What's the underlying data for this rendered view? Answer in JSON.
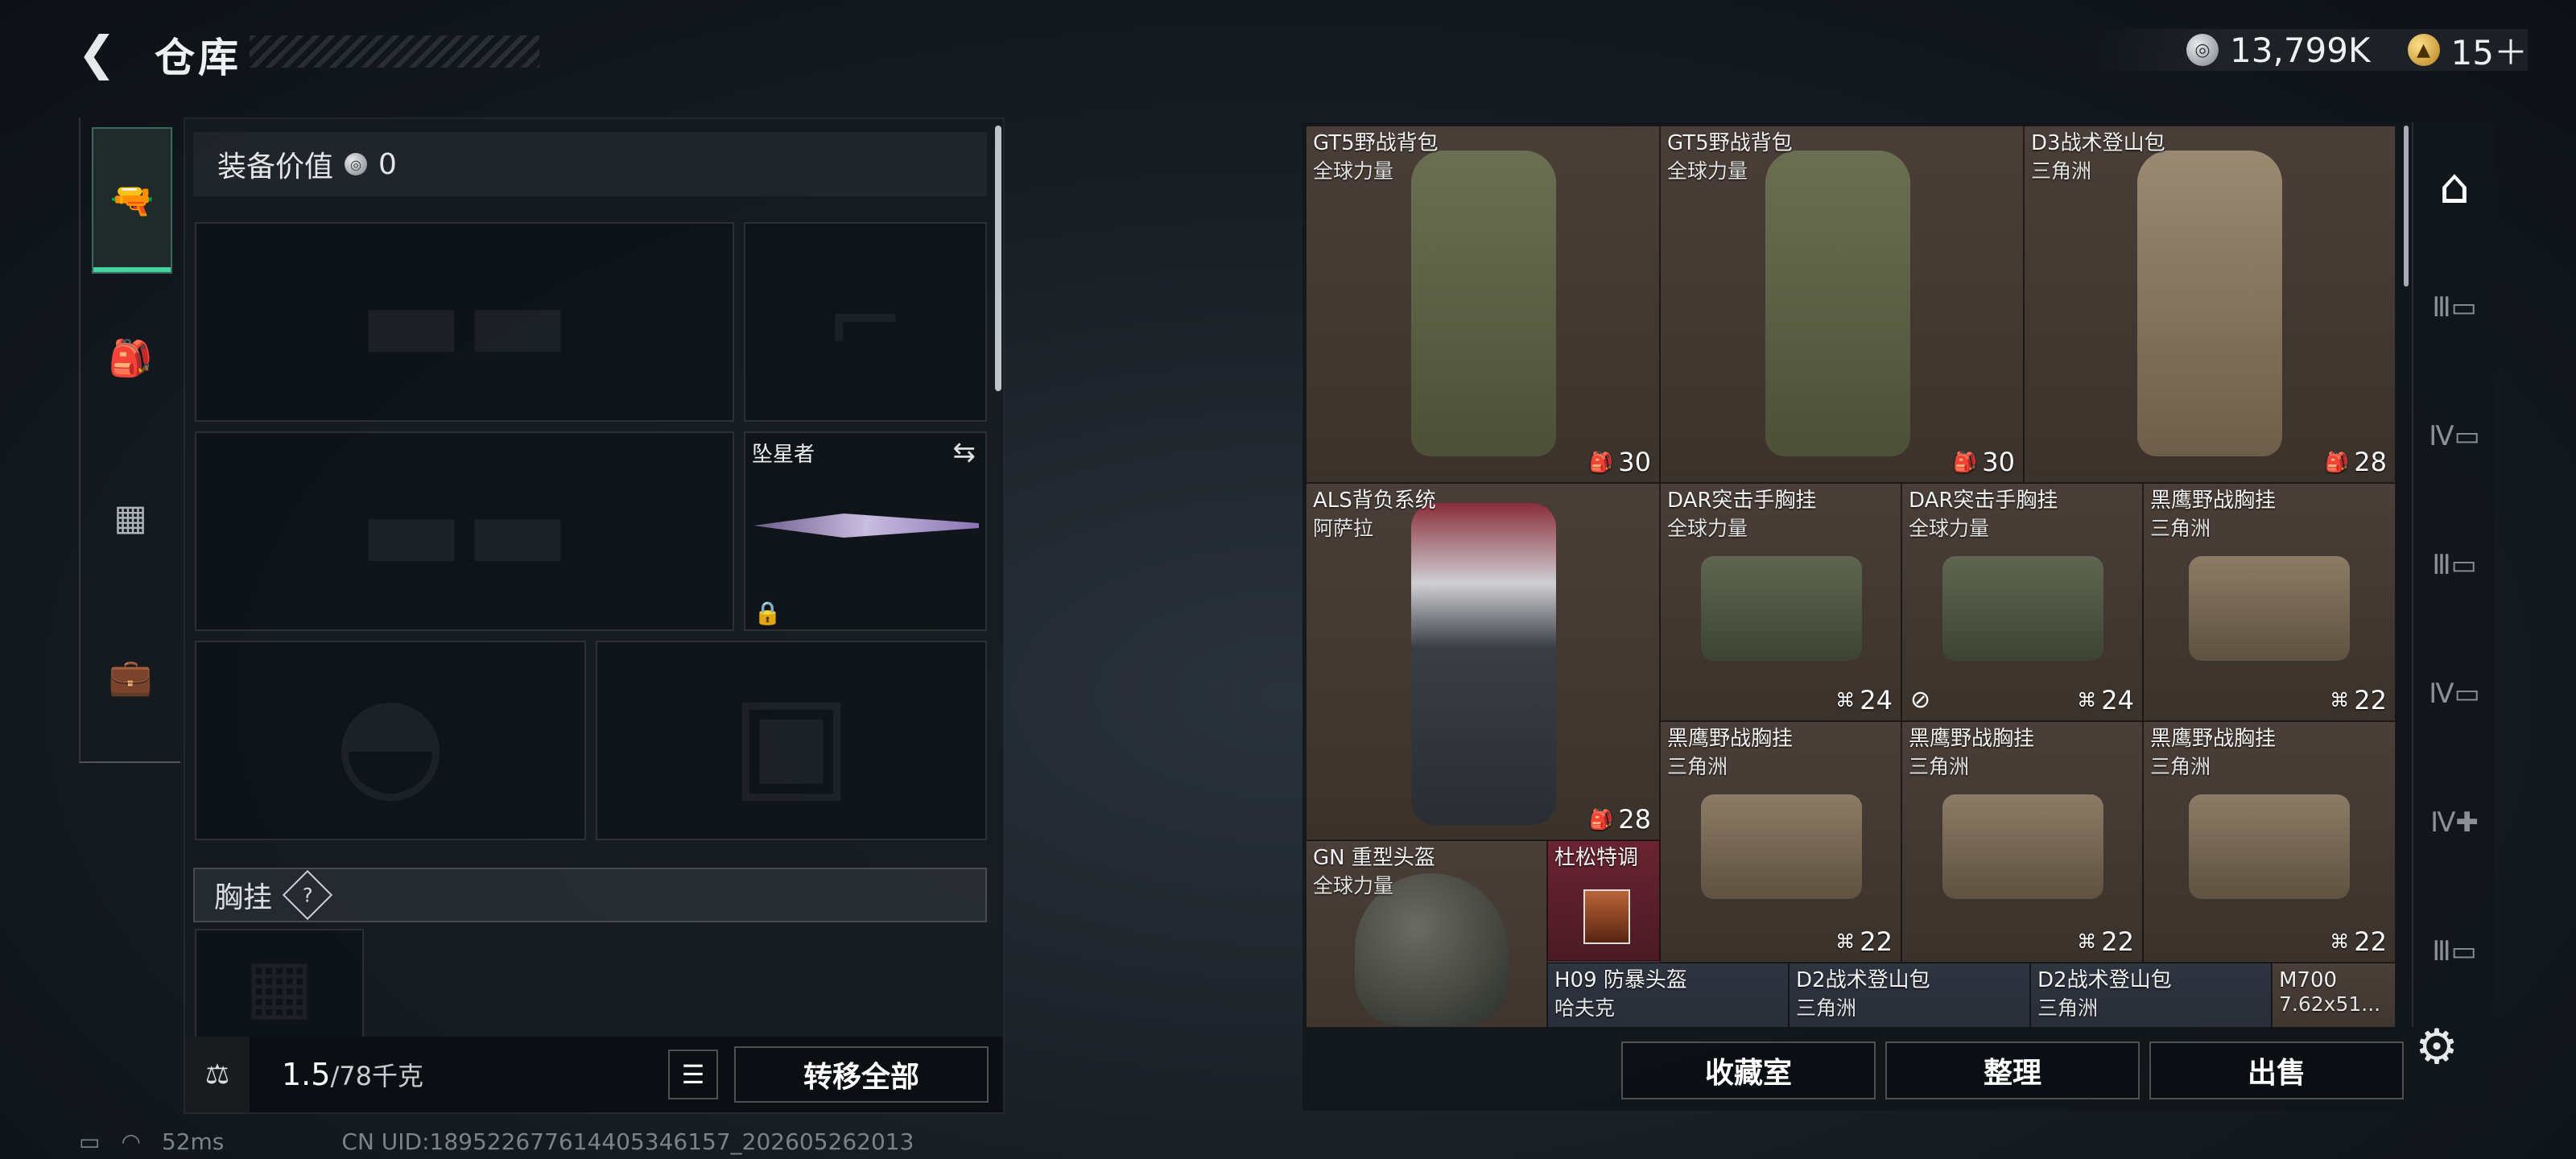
{
  "header": {
    "back_icon": "back-chevron-icon",
    "title": "仓库"
  },
  "currency": {
    "silver_amount": "13,799K",
    "gold_amount": "15＋",
    "silver_icon": "silver-coin-icon",
    "gold_icon": "gold-coin-icon"
  },
  "tabs": [
    {
      "icon": "pistol-icon",
      "active": true
    },
    {
      "icon": "backpack-icon",
      "active": false
    },
    {
      "icon": "vest-icon",
      "active": false
    },
    {
      "icon": "case-icon",
      "active": false
    }
  ],
  "loadout": {
    "value_label": "装备价值",
    "value": "0",
    "melee_name": "坠星者",
    "chest_label": "胸挂",
    "help": "?",
    "weight_current": "1.5",
    "weight_max": "/78千克",
    "transfer_all": "转移全部"
  },
  "storage": {
    "items": [
      {
        "name": "GT5野战背包",
        "sub": "全球力量",
        "cap": "30",
        "cap_icon": "backpack-cap-icon"
      },
      {
        "name": "GT5野战背包",
        "sub": "全球力量",
        "cap": "30",
        "cap_icon": "backpack-cap-icon"
      },
      {
        "name": "D3战术登山包",
        "sub": "三角洲",
        "cap": "28",
        "cap_icon": "backpack-cap-icon"
      },
      {
        "name": "ALS背负系统",
        "sub": "阿萨拉",
        "cap": "28",
        "cap_icon": "backpack-cap-icon"
      },
      {
        "name": "DAR突击手胸挂",
        "sub": "全球力量",
        "cap": "24",
        "cap_icon": "rig-cap-icon"
      },
      {
        "name": "DAR突击手胸挂",
        "sub": "全球力量",
        "cap": "24",
        "cap_icon": "rig-cap-icon"
      },
      {
        "name": "黑鹰野战胸挂",
        "sub": "三角洲",
        "cap": "22",
        "cap_icon": "rig-cap-icon"
      },
      {
        "name": "黑鹰野战胸挂",
        "sub": "三角洲",
        "cap": "22",
        "cap_icon": "rig-cap-icon"
      },
      {
        "name": "黑鹰野战胸挂",
        "sub": "三角洲",
        "cap": "22",
        "cap_icon": "rig-cap-icon"
      },
      {
        "name": "黑鹰野战胸挂",
        "sub": "三角洲",
        "cap": "22",
        "cap_icon": "rig-cap-icon"
      },
      {
        "name": "GN 重型头盔",
        "sub": "全球力量"
      },
      {
        "name": "杜松特调",
        "sub": ""
      },
      {
        "name": "H09 防暴头盔",
        "sub": "哈夫克"
      },
      {
        "name": "D2战术登山包",
        "sub": "三角洲"
      },
      {
        "name": "D2战术登山包",
        "sub": "三角洲"
      },
      {
        "name": "M700",
        "sub": "7.62x51..."
      }
    ],
    "buttons": {
      "collection": "收藏室",
      "organize": "整理",
      "sell": "出售"
    }
  },
  "status": {
    "ping": "52ms",
    "uid": "CN UID:18952267761440534615​7_202605262013"
  },
  "colors": {
    "accent_green": "#46d3a0"
  }
}
